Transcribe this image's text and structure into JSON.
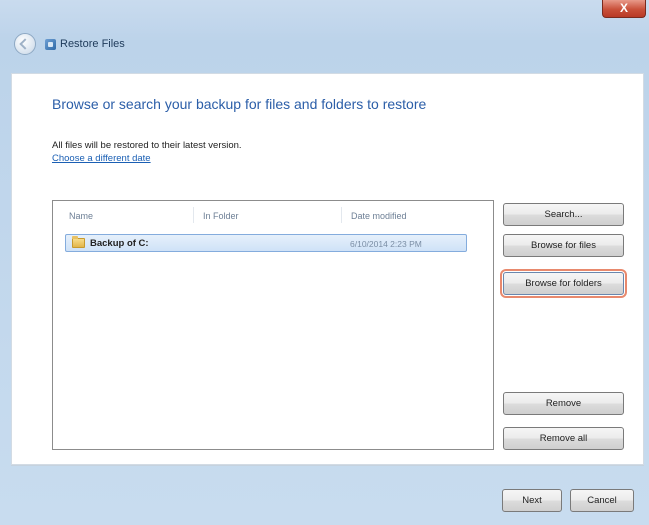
{
  "window": {
    "title": "Restore Files",
    "close_label": "X"
  },
  "content": {
    "heading": "Browse or search your backup for files and folders to restore",
    "note": "All files will be restored to their latest version.",
    "link": "Choose a different date"
  },
  "file_list": {
    "columns": [
      "Name",
      "In Folder",
      "Date modified"
    ],
    "rows": [
      {
        "name": "Backup of C:",
        "folder": "",
        "date": "6/10/2014 2:23 PM"
      }
    ]
  },
  "side_buttons": {
    "search": "Search...",
    "browse_files": "Browse for files",
    "browse_folders": "Browse for folders",
    "remove": "Remove",
    "remove_all": "Remove all"
  },
  "footer": {
    "next": "Next",
    "cancel": "Cancel"
  },
  "colors": {
    "heading": "#2b5ea8",
    "link": "#1a5fb4",
    "highlight": "#e8896d"
  }
}
